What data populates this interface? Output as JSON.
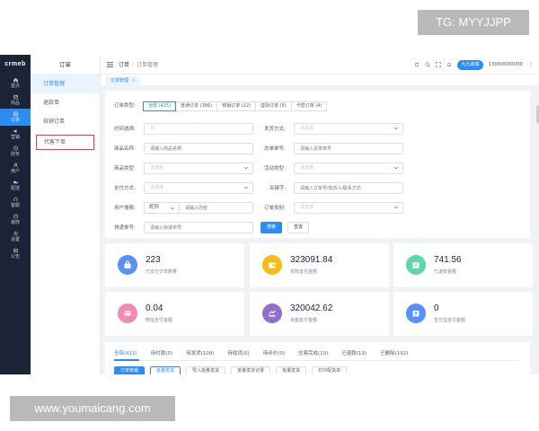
{
  "watermarks": {
    "top": "TG: MYYJJPP",
    "bottom": "www.youmaicang.com"
  },
  "sidebar": {
    "logo": "crmeb",
    "items": [
      {
        "label": "首页",
        "icon": "home-icon"
      },
      {
        "label": "商品",
        "icon": "goods-icon"
      },
      {
        "label": "订单",
        "icon": "order-icon",
        "active": true
      },
      {
        "label": "营销",
        "icon": "marketing-icon"
      },
      {
        "label": "财务",
        "icon": "finance-icon"
      },
      {
        "label": "用户",
        "icon": "user-icon"
      },
      {
        "label": "配送",
        "icon": "delivery-icon"
      },
      {
        "label": "客服",
        "icon": "service-icon"
      },
      {
        "label": "装修",
        "icon": "decoration-icon"
      },
      {
        "label": "设置",
        "icon": "settings-icon"
      },
      {
        "label": "公告",
        "icon": "notice-icon"
      }
    ]
  },
  "submenu": {
    "title": "订单",
    "items": [
      {
        "label": "订单管理",
        "active": true
      },
      {
        "label": "退款单"
      },
      {
        "label": "核销订单"
      },
      {
        "label": "代客下单",
        "outlined": true
      }
    ]
  },
  "header": {
    "crumb_root": "订单",
    "crumb_current": "订单管理",
    "store_badge": "九九商城",
    "account": "13000000000"
  },
  "tabsbar": {
    "tab": "订单管理",
    "close": "×"
  },
  "filters": {
    "order_type_label": "订单类型:",
    "order_types": [
      "全部 (415)",
      "普通订单 (386)",
      "核销订单 (22)",
      "虚拟订单 (5)",
      "卡密订单 (4)"
    ],
    "time_label": "时间选择:",
    "time_start_placeholder": "日",
    "time_sep": "-",
    "ship_label": "发货方式:",
    "ship_placeholder": "请选择",
    "product_name_label": "商品名称:",
    "product_name_placeholder": "请输入商品名称",
    "total_order_label": "总单单号:",
    "total_order_placeholder": "请输入总单单号",
    "product_type_label": "商品类型:",
    "product_type_placeholder": "请选择",
    "activity_type_label": "活动类型:",
    "activity_type_placeholder": "请选择",
    "pay_method_label": "支付方式:",
    "pay_method_placeholder": "请选择",
    "keyword_label": "关键字:",
    "keyword_placeholder": "请输入订单号/收货人/联系方式",
    "user_search_label": "用户搜索:",
    "user_search_select": "昵称",
    "user_search_placeholder": "请输入内容",
    "order_category_label": "订单类别:",
    "order_category_placeholder": "请选择",
    "express_label": "快递单号:",
    "express_placeholder": "请输入快递单号",
    "search_button": "搜索",
    "reset_button": "重置"
  },
  "stats": [
    {
      "value": "223",
      "caption": "已支付订单数量",
      "color": "#5b8ff9",
      "icon": "bag-icon"
    },
    {
      "value": "323091.84",
      "caption": "实际支付金额",
      "color": "#f6bd16",
      "icon": "wallet-icon"
    },
    {
      "value": "741.56",
      "caption": "已退款金额",
      "color": "#5ad8a6",
      "icon": "refund-icon"
    },
    {
      "value": "0.04",
      "caption": "微信支付金额",
      "color": "#f08bb4",
      "icon": "wechat-pay-icon"
    },
    {
      "value": "320042.62",
      "caption": "余额支付金额",
      "color": "#9270ca",
      "icon": "balance-icon"
    },
    {
      "value": "0",
      "caption": "支付宝支付金额",
      "color": "#5b8ff9",
      "icon": "alipay-icon"
    }
  ],
  "status_tabs": [
    "全部(415)",
    "待付款(0)",
    "待发货(109)",
    "待收货(0)",
    "待评价(0)",
    "交易完成(10)",
    "已退款(13)",
    "已删除(192)"
  ],
  "actions": [
    "订单核销",
    "批量发货",
    "导入批量发货",
    "批量发货记录",
    "批量发货",
    "打印配货单"
  ]
}
